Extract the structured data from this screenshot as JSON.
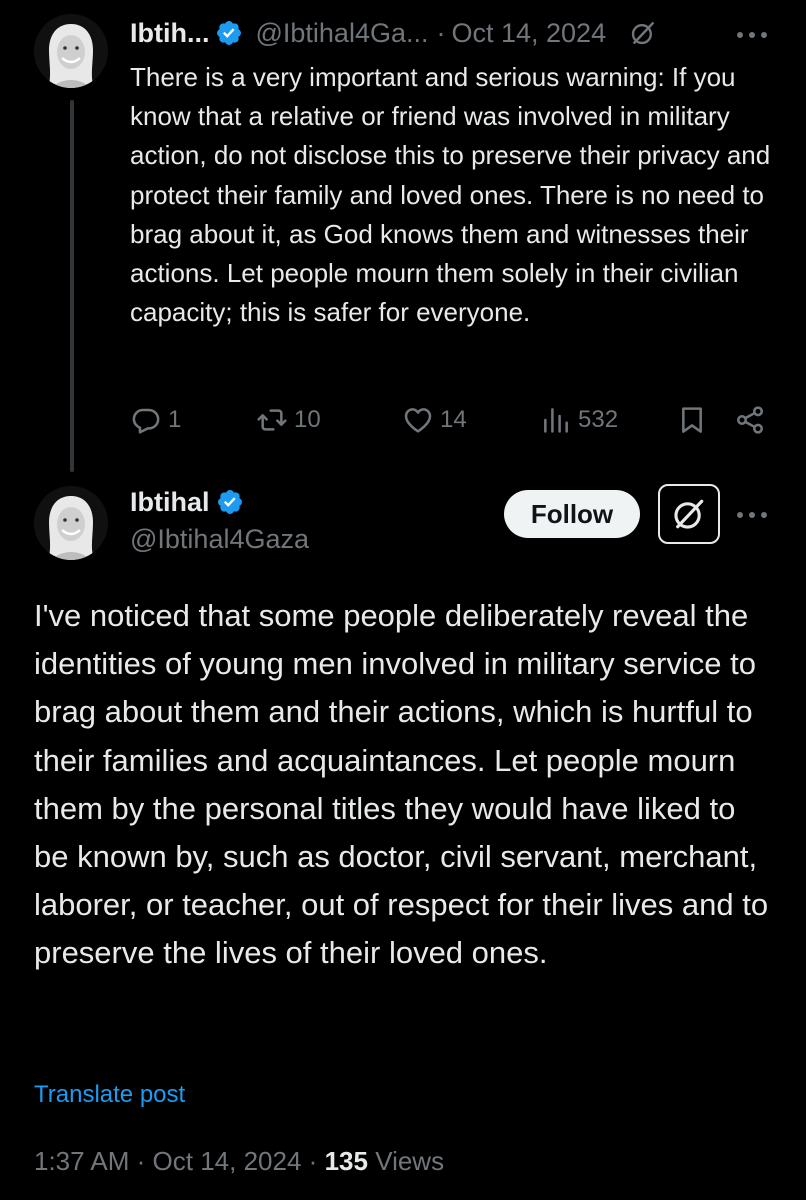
{
  "parent_tweet": {
    "name": "Ibtih...",
    "handle": "@Ibtihal4Ga...",
    "separator": "·",
    "date": "Oct 14, 2024",
    "text": "There is a very important and serious warning: If you know that a relative or friend was involved in military action, do not disclose this to preserve their privacy and protect their family and loved ones. There is no need to brag about it, as God knows them and witnesses their actions. Let people mourn them solely in their civilian capacity; this is safer for everyone.",
    "replies": "1",
    "reposts": "10",
    "likes": "14",
    "views": "532",
    "icons": [
      "verified-badge-icon",
      "grok-icon",
      "more-icon",
      "reply-icon",
      "repost-icon",
      "like-icon",
      "views-icon",
      "bookmark-icon",
      "share-icon"
    ]
  },
  "main_tweet": {
    "name": "Ibtihal",
    "handle": "@Ibtihal4Gaza",
    "follow_label": "Follow",
    "text": "I've noticed that some people deliberately reveal the identities of young men involved in military service to brag about them and their actions, which is hurtful to their families and acquaintances. Let people mourn them by the personal titles they would have liked to be known by, such as doctor, civil servant, merchant, laborer, or teacher, out of respect for their lives and to preserve the lives of their loved ones.",
    "translate_label": "Translate post",
    "time": "1:37 AM",
    "separator": "·",
    "date": "Oct 14, 2024",
    "views_count": "135",
    "views_label": "Views"
  },
  "colors": {
    "background": "#000000",
    "text": "#e7e9ea",
    "muted": "#71767b",
    "link": "#1d9bf0",
    "verified": "#1d9bf0",
    "thread_line": "#333639"
  }
}
